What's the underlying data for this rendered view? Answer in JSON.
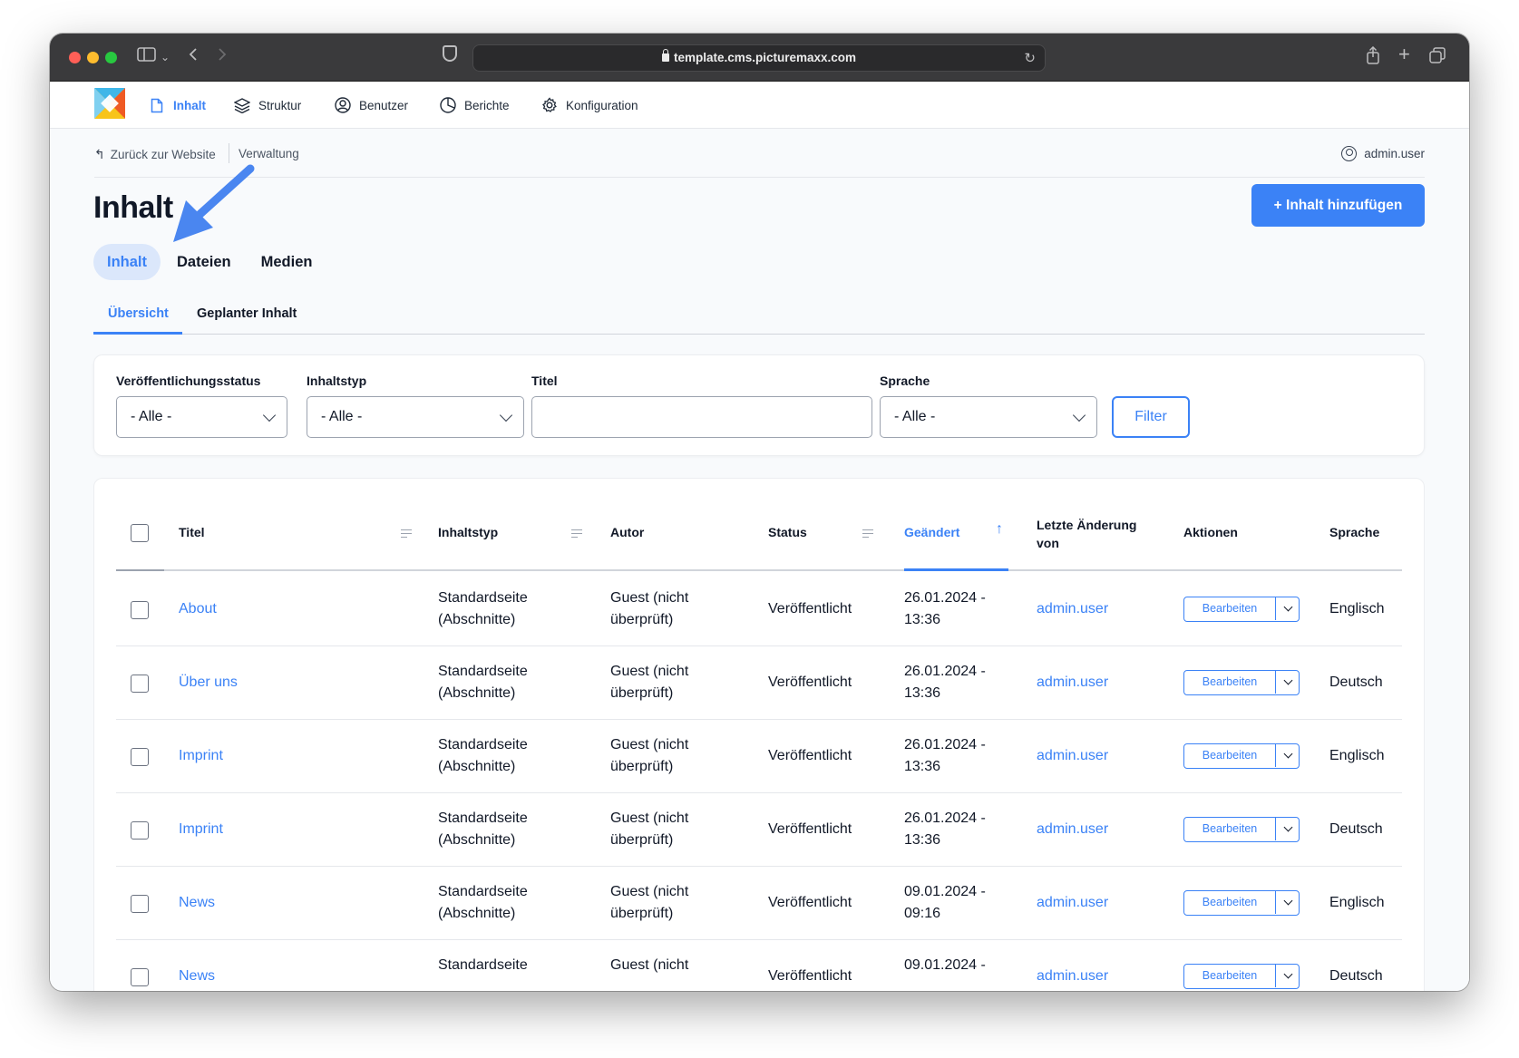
{
  "browser": {
    "url": "template.cms.picturemaxx.com"
  },
  "nav": {
    "items": [
      {
        "label": "Inhalt",
        "icon": "document-icon",
        "active": true
      },
      {
        "label": "Struktur",
        "icon": "layers-icon",
        "active": false
      },
      {
        "label": "Benutzer",
        "icon": "user-circle-icon",
        "active": false
      },
      {
        "label": "Berichte",
        "icon": "pie-chart-icon",
        "active": false
      },
      {
        "label": "Konfiguration",
        "icon": "gear-icon",
        "active": false
      }
    ]
  },
  "topbar": {
    "back_label": "Zurück zur Website",
    "section_label": "Verwaltung",
    "user_label": "admin.user"
  },
  "page": {
    "title": "Inhalt",
    "add_button": "+ Inhalt hinzufügen"
  },
  "main_tabs": [
    {
      "label": "Inhalt",
      "active": true
    },
    {
      "label": "Dateien",
      "active": false
    },
    {
      "label": "Medien",
      "active": false
    }
  ],
  "sub_tabs": [
    {
      "label": "Übersicht",
      "active": true
    },
    {
      "label": "Geplanter Inhalt",
      "active": false
    }
  ],
  "filters": {
    "status": {
      "label": "Veröffentlichungsstatus",
      "value": "- Alle -"
    },
    "type": {
      "label": "Inhaltstyp",
      "value": "- Alle -"
    },
    "title": {
      "label": "Titel",
      "value": ""
    },
    "language": {
      "label": "Sprache",
      "value": "- Alle -"
    },
    "button": "Filter"
  },
  "table": {
    "headers": {
      "title": "Titel",
      "type": "Inhaltstyp",
      "author": "Autor",
      "status": "Status",
      "changed": "Geändert",
      "last_changed_by_1": "Letzte Änderung",
      "last_changed_by_2": "von",
      "actions": "Aktionen",
      "language": "Sprache"
    },
    "edit_label": "Bearbeiten",
    "rows": [
      {
        "title": "About",
        "type1": "Standardseite",
        "type2": "(Abschnitte)",
        "author1": "Guest (nicht",
        "author2": "überprüft)",
        "status": "Veröffentlicht",
        "date1": "26.01.2024 -",
        "date2": "13:36",
        "user": "admin.user",
        "language": "Englisch"
      },
      {
        "title": "Über uns",
        "type1": "Standardseite",
        "type2": "(Abschnitte)",
        "author1": "Guest (nicht",
        "author2": "überprüft)",
        "status": "Veröffentlicht",
        "date1": "26.01.2024 -",
        "date2": "13:36",
        "user": "admin.user",
        "language": "Deutsch"
      },
      {
        "title": "Imprint",
        "type1": "Standardseite",
        "type2": "(Abschnitte)",
        "author1": "Guest (nicht",
        "author2": "überprüft)",
        "status": "Veröffentlicht",
        "date1": "26.01.2024 -",
        "date2": "13:36",
        "user": "admin.user",
        "language": "Englisch"
      },
      {
        "title": "Imprint",
        "type1": "Standardseite",
        "type2": "(Abschnitte)",
        "author1": "Guest (nicht",
        "author2": "überprüft)",
        "status": "Veröffentlicht",
        "date1": "26.01.2024 -",
        "date2": "13:36",
        "user": "admin.user",
        "language": "Deutsch"
      },
      {
        "title": "News",
        "type1": "Standardseite",
        "type2": "(Abschnitte)",
        "author1": "Guest (nicht",
        "author2": "überprüft)",
        "status": "Veröffentlicht",
        "date1": "09.01.2024 -",
        "date2": "09:16",
        "user": "admin.user",
        "language": "Englisch"
      },
      {
        "title": "News",
        "type1": "Standardseite",
        "type2": "",
        "author1": "Guest (nicht",
        "author2": "",
        "status": "Veröffentlicht",
        "date1": "09.01.2024 -",
        "date2": "",
        "user": "admin.user",
        "language": "Deutsch"
      }
    ]
  },
  "colors": {
    "accent": "#3b82f6",
    "annotation_arrow": "#4a86f0",
    "tab_active_bg": "#dbe7fb"
  }
}
